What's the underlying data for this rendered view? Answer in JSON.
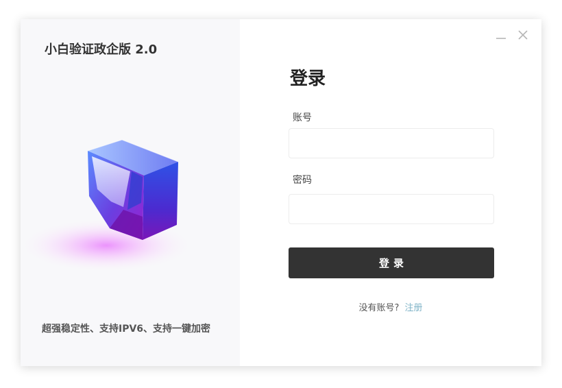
{
  "app": {
    "title": "小白验证政企版 2.0",
    "tagline": "超强稳定性、支持IPV6、支持一键加密"
  },
  "window_controls": {
    "minimize_icon": "minimize-icon",
    "close_icon": "close-icon"
  },
  "login": {
    "heading": "登录",
    "account_label": "账号",
    "account_value": "",
    "account_placeholder": "",
    "password_label": "密码",
    "password_value": "",
    "password_placeholder": "",
    "submit_label": "登录",
    "no_account_text": "没有账号?",
    "register_link": "注册"
  },
  "colors": {
    "left_panel_bg": "#f8f8fa",
    "button_bg": "#333333",
    "link": "#7fb3c7",
    "cube_blue": "#3b4fe0",
    "cube_purple": "#8a24c9"
  }
}
